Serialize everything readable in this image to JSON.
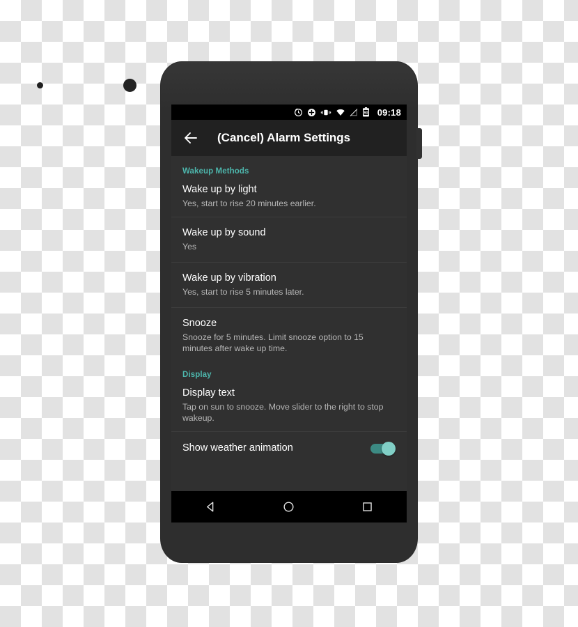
{
  "device": {
    "name": "android-phone-mockup",
    "frame_color": "#2e2e2e"
  },
  "status_bar": {
    "time": "09:18",
    "icons": [
      {
        "name": "alarm-clock-icon",
        "label": "Alarm set"
      },
      {
        "name": "add-circle-icon",
        "label": "Add"
      },
      {
        "name": "vibrate-icon",
        "label": "Vibrate mode"
      },
      {
        "name": "wifi-icon",
        "label": "Wi-Fi connected"
      },
      {
        "name": "no-sim-icon",
        "label": "No SIM / signal off"
      },
      {
        "name": "battery-icon",
        "label": "Battery",
        "level": "90"
      }
    ]
  },
  "app_bar": {
    "back_label": "Back",
    "title": "(Cancel) Alarm Settings"
  },
  "settings": {
    "sections": [
      {
        "header": "Wakeup Methods",
        "rows": [
          {
            "title": "Wake up by light",
            "subtitle": "Yes, start to rise 20 minutes earlier."
          },
          {
            "title": "Wake up by sound",
            "subtitle": "Yes"
          },
          {
            "title": "Wake up by vibration",
            "subtitle": "Yes, start to rise 5 minutes later."
          },
          {
            "title": "Snooze",
            "subtitle": "Snooze for 5 minutes. Limit snooze option to 15 minutes after wake up time."
          }
        ]
      },
      {
        "header": "Display",
        "rows": [
          {
            "title": "Display text",
            "subtitle": "Tap on sun to snooze. Move slider to the right to stop wakeup."
          },
          {
            "title": "Show weather animation",
            "toggle": "on"
          }
        ]
      }
    ]
  },
  "nav_bar": {
    "buttons": [
      {
        "name": "back-nav-button",
        "label": "Back"
      },
      {
        "name": "home-nav-button",
        "label": "Home"
      },
      {
        "name": "recents-nav-button",
        "label": "Recent apps"
      }
    ]
  },
  "colors": {
    "accent": "#4db6ac",
    "app_bar_bg": "#212121",
    "content_bg": "#303030",
    "status_bar_bg": "#000000",
    "primary_text": "#ffffff",
    "secondary_text": "#b6b6b6",
    "toggle_on": "#81cfc6"
  }
}
